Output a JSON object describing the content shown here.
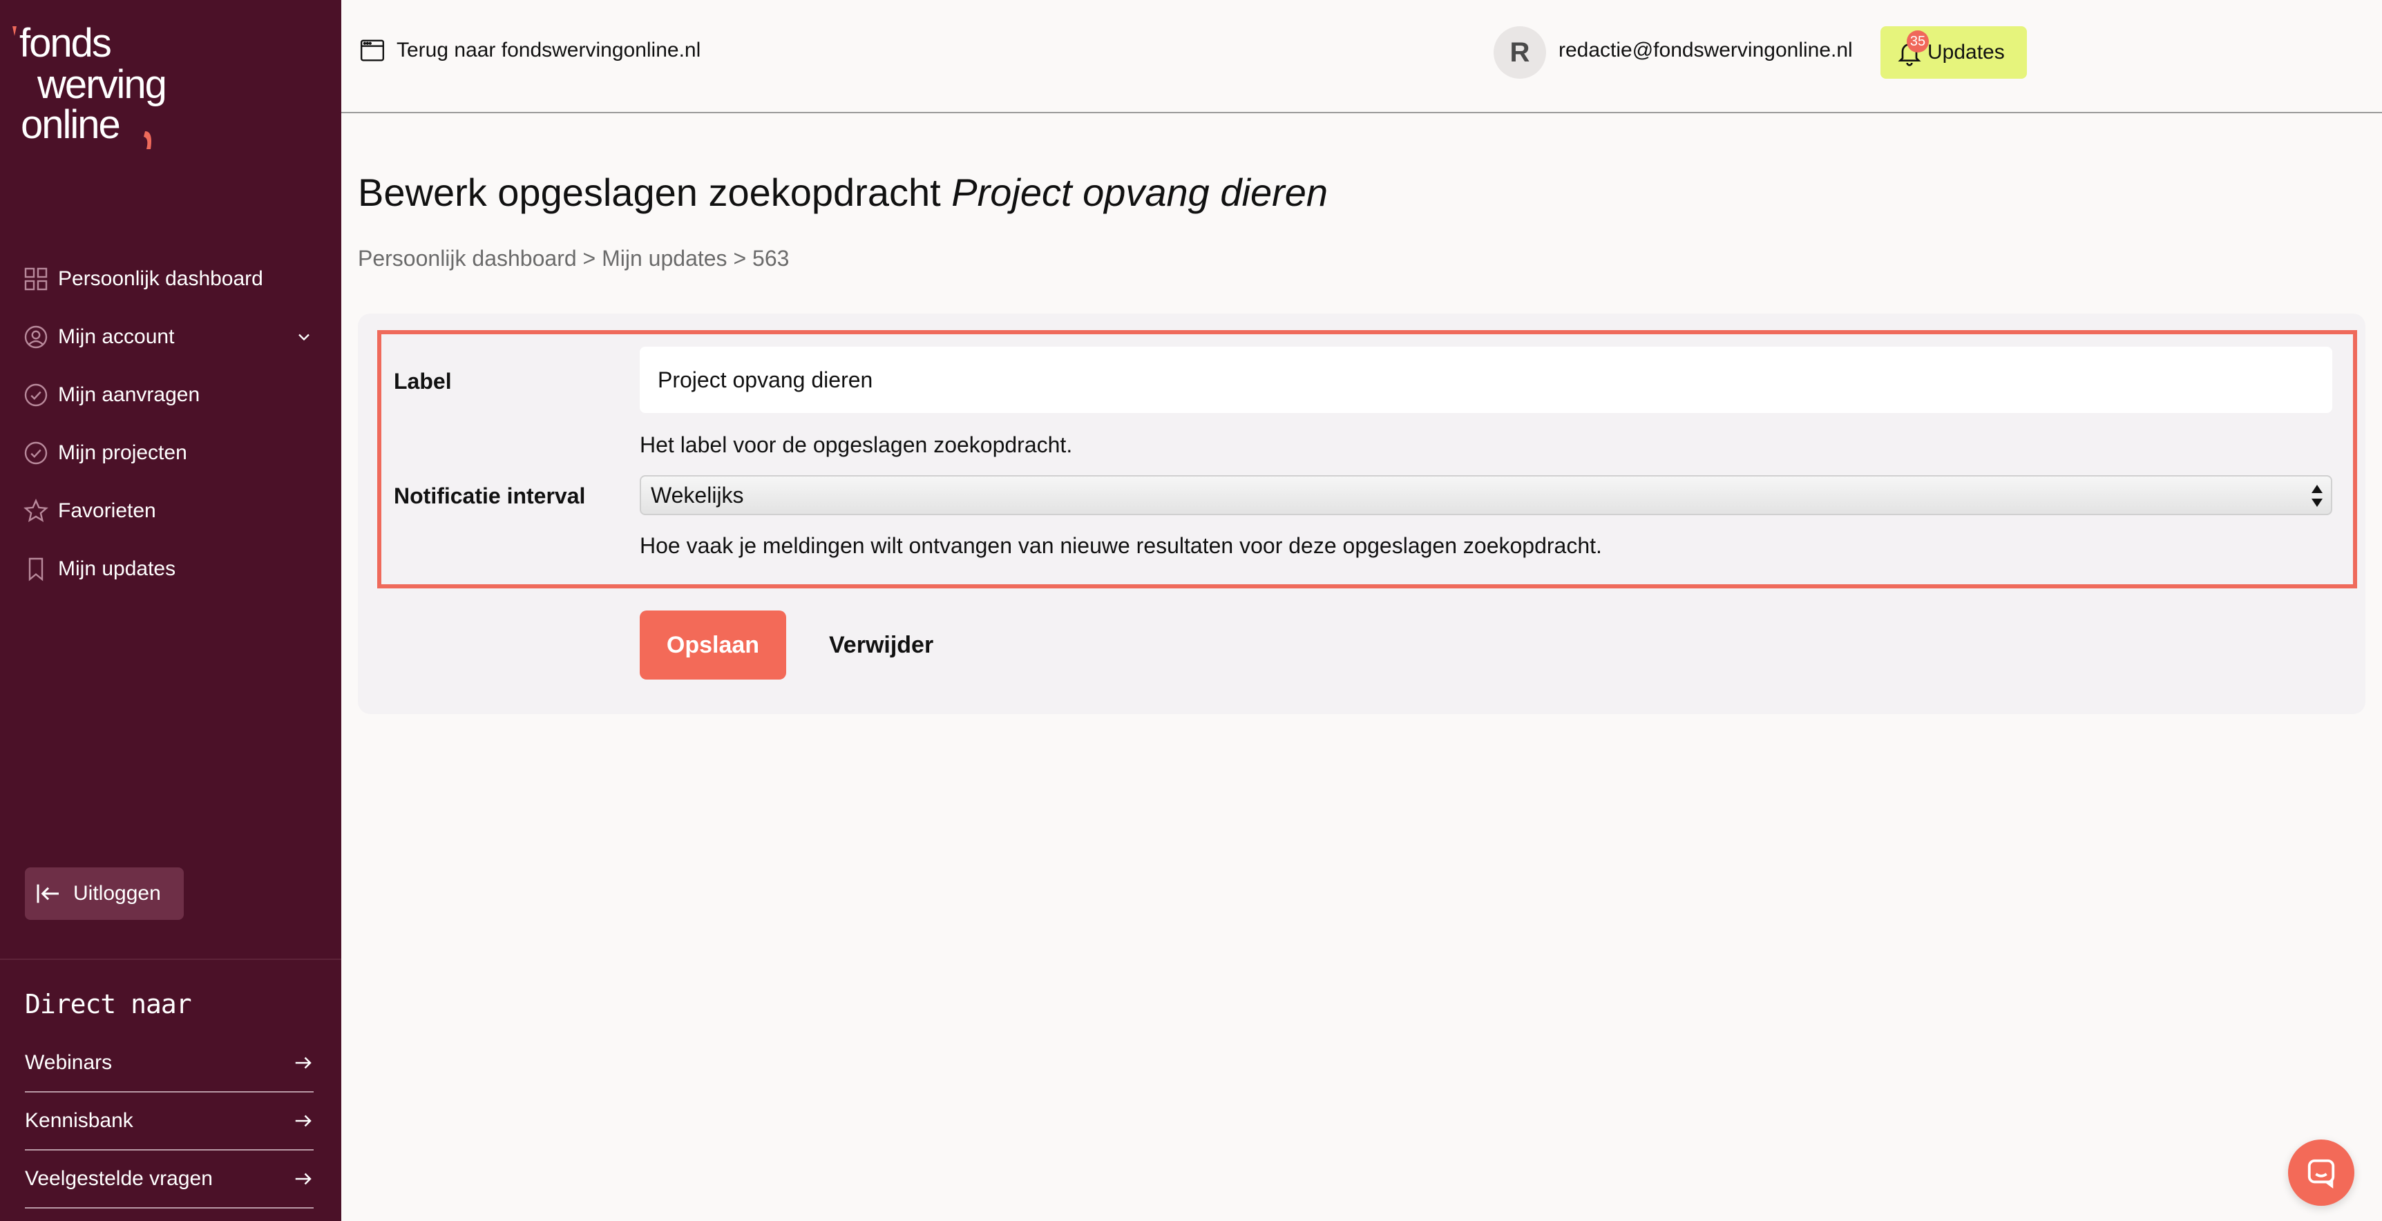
{
  "brand": {
    "logo_line1": "fonds",
    "logo_line2": "werving",
    "logo_line3": "online",
    "accent_color": "#ef6a5b",
    "sidebar_color": "#4b1128"
  },
  "sidebar": {
    "items": [
      {
        "label": "Persoonlijk dashboard",
        "icon": "dashboard-grid-icon"
      },
      {
        "label": "Mijn account",
        "icon": "user-circle-icon"
      },
      {
        "label": "Mijn aanvragen",
        "icon": "check-circle-icon"
      },
      {
        "label": "Mijn projecten",
        "icon": "check-circle-icon"
      },
      {
        "label": "Favorieten",
        "icon": "star-icon"
      },
      {
        "label": "Mijn updates",
        "icon": "bookmark-icon"
      }
    ],
    "logout_label": "Uitloggen",
    "direct_title": "Direct naar",
    "direct_links": [
      {
        "label": "Webinars"
      },
      {
        "label": "Kennisbank"
      },
      {
        "label": "Veelgestelde vragen"
      }
    ]
  },
  "topbar": {
    "back_label": "Terug naar fondswervingonline.nl",
    "avatar_initial": "R",
    "user_email": "redactie@fondswervingonline.nl",
    "updates_label": "Updates",
    "updates_count": "35"
  },
  "main": {
    "title_prefix": "Bewerk opgeslagen zoekopdracht",
    "title_name": "Project opvang dieren",
    "breadcrumb": "Persoonlijk dashboard > Mijn updates > 563",
    "form": {
      "label_field_label": "Label",
      "label_value": "Project opvang dieren",
      "label_help": "Het label voor de opgeslagen zoekopdracht.",
      "interval_label": "Notificatie interval",
      "interval_value": "Wekelijks",
      "interval_help": "Hoe vaak je meldingen wilt ontvangen van nieuwe resultaten voor deze opgeslagen zoekopdracht.",
      "save_label": "Opslaan",
      "delete_label": "Verwijder"
    }
  }
}
